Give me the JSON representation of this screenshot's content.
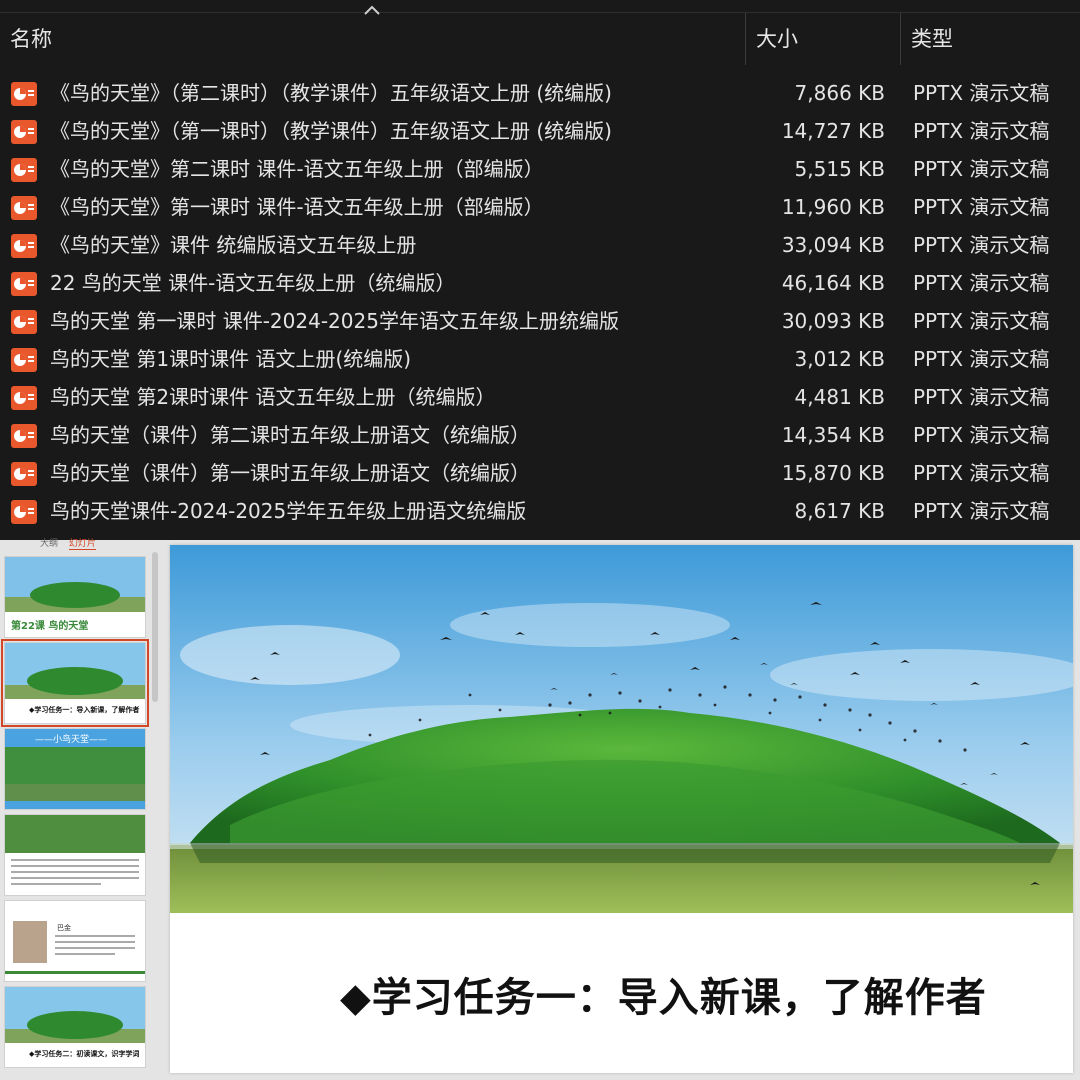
{
  "explorer": {
    "columns": {
      "name": "名称",
      "size": "大小",
      "type": "类型"
    },
    "files": [
      {
        "name": "《鸟的天堂》（第二课时）（教学课件）五年级语文上册 (统编版)",
        "size": "7,866 KB",
        "type": "PPTX 演示文稿"
      },
      {
        "name": "《鸟的天堂》（第一课时）（教学课件）五年级语文上册 (统编版)",
        "size": "14,727 KB",
        "type": "PPTX 演示文稿"
      },
      {
        "name": "《鸟的天堂》第二课时 课件-语文五年级上册（部编版）",
        "size": "5,515 KB",
        "type": "PPTX 演示文稿"
      },
      {
        "name": "《鸟的天堂》第一课时 课件-语文五年级上册（部编版）",
        "size": "11,960 KB",
        "type": "PPTX 演示文稿"
      },
      {
        "name": "《鸟的天堂》课件 统编版语文五年级上册",
        "size": "33,094 KB",
        "type": "PPTX 演示文稿"
      },
      {
        "name": "22 鸟的天堂 课件-语文五年级上册（统编版）",
        "size": "46,164 KB",
        "type": "PPTX 演示文稿"
      },
      {
        "name": "鸟的天堂  第一课时 课件-2024-2025学年语文五年级上册统编版",
        "size": "30,093 KB",
        "type": "PPTX 演示文稿"
      },
      {
        "name": "鸟的天堂 第1课时课件 语文上册(统编版)",
        "size": "3,012 KB",
        "type": "PPTX 演示文稿"
      },
      {
        "name": "鸟的天堂 第2课时课件 语文五年级上册（统编版）",
        "size": "4,481 KB",
        "type": "PPTX 演示文稿"
      },
      {
        "name": "鸟的天堂（课件）第二课时五年级上册语文（统编版）",
        "size": "14,354 KB",
        "type": "PPTX 演示文稿"
      },
      {
        "name": "鸟的天堂（课件）第一课时五年级上册语文（统编版）",
        "size": "15,870 KB",
        "type": "PPTX 演示文稿"
      },
      {
        "name": "鸟的天堂课件-2024-2025学年五年级上册语文统编版",
        "size": "8,617 KB",
        "type": "PPTX 演示文稿"
      }
    ],
    "icon": "pptx-file-icon",
    "icon_color": "#e8582c"
  },
  "ppt": {
    "thumb_tabs": [
      "大纲",
      "幻灯片"
    ],
    "thumbnails": [
      {
        "caption": "第22课  鸟的天堂"
      },
      {
        "caption": "◆学习任务一：导入新课，了解作者"
      },
      {
        "caption": "——小鸟天堂——"
      },
      {
        "caption": ""
      },
      {
        "caption": "巴金"
      },
      {
        "caption": "◆学习任务二：初读课文，识字学词"
      }
    ],
    "slide": {
      "heading": "◆学习任务一：导入新课，了解作者"
    },
    "accent_color": "#d24726"
  }
}
